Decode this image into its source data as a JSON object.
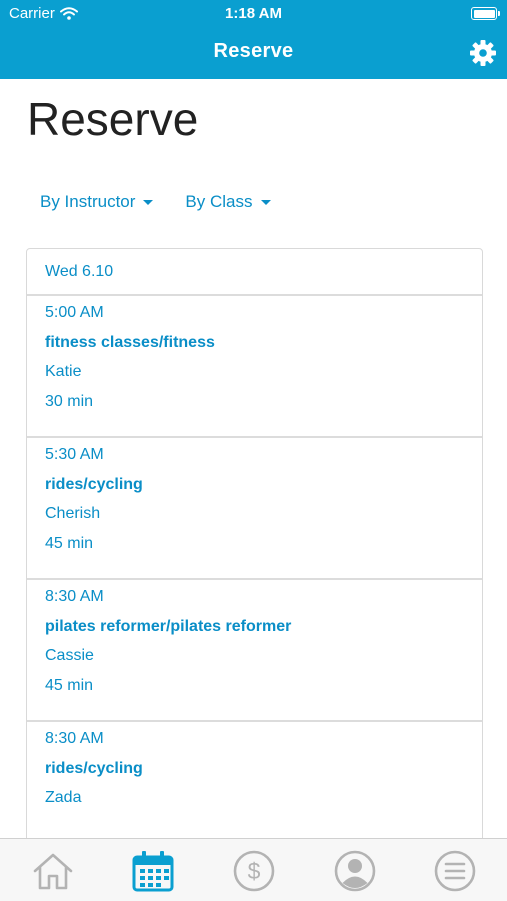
{
  "status": {
    "carrier": "Carrier",
    "time": "1:18 AM"
  },
  "nav": {
    "title": "Reserve",
    "settings_icon": "gear-icon"
  },
  "page": {
    "title": "Reserve"
  },
  "filters": [
    {
      "label": "By Instructor"
    },
    {
      "label": "By Class"
    }
  ],
  "schedule": {
    "date": "Wed 6.10",
    "sessions": [
      {
        "time": "5:00 AM",
        "class": "fitness classes/fitness",
        "instructor": "Katie",
        "duration": "30 min"
      },
      {
        "time": "5:30 AM",
        "class": "rides/cycling",
        "instructor": "Cherish",
        "duration": "45 min"
      },
      {
        "time": "8:30 AM",
        "class": "pilates reformer/pilates reformer",
        "instructor": "Cassie",
        "duration": "45 min"
      },
      {
        "time": "8:30 AM",
        "class": "rides/cycling",
        "instructor": "Zada",
        "duration": ""
      }
    ]
  },
  "tabs": [
    {
      "icon": "home-icon",
      "active": false
    },
    {
      "icon": "calendar-icon",
      "active": true
    },
    {
      "icon": "dollar-icon",
      "active": false
    },
    {
      "icon": "profile-icon",
      "active": false
    },
    {
      "icon": "menu-icon",
      "active": false
    }
  ],
  "colors": {
    "accent": "#0a9fd0",
    "link": "#0a8ec7",
    "inactive_icon": "#b3b3b3"
  }
}
